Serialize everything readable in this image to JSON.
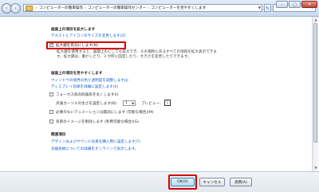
{
  "address": {
    "breadcrumbs": [
      "コンピューターの簡単操作",
      "コンピューターの簡単操作センター",
      "コンピューターを見やすくします"
    ],
    "separator": "›"
  },
  "sections": {
    "magnify": {
      "title": "画面上の項目を拡大します",
      "link_text_size": "テキストとアイコンのサイズを変更します(Z)",
      "checkbox_label": "拡大鏡を有効にします(N)",
      "checkbox_checked": true,
      "description_line1": "拡大鏡を使用すると、画面上のどこでも拡大でき、その場所にあるすべての項目を拡大表示できま",
      "description_line2": "す。拡大鏡は、動かしたり、3 か所に固定したり、大きさを変更したりできます。"
    },
    "visibility": {
      "title": "画面上の項目を見やすくします",
      "link_border": "ウィンドウの境界の色と透明度を調整します(J)",
      "link_effects": "ディスプレイ効果を詳細に設定します(E)",
      "focus_label": "フォーカス枠の四角形を太くします(I)",
      "cursor_width_label": "点滅カーソルの太さを設定します(B):",
      "cursor_width_value": "1",
      "preview_label": "プレビュー:",
      "animations_label": "必要のないアニメーションは無効にします (可能な場合)(M)",
      "background_label": "背景のイメージを削除します (利用可能な場合)(G)"
    },
    "related": {
      "title": "関連項目",
      "link_sound": "デザインおよびサウンド効果を購入用に設定します(T)",
      "link_assistive": "支援技術についての詳細をオンラインで表示します。"
    }
  },
  "buttons": {
    "ok": "OK(O)",
    "cancel": "キャンセル",
    "apply": "適用(A)"
  },
  "colors": {
    "highlight": "#d40000",
    "link": "#1a5fc9"
  }
}
